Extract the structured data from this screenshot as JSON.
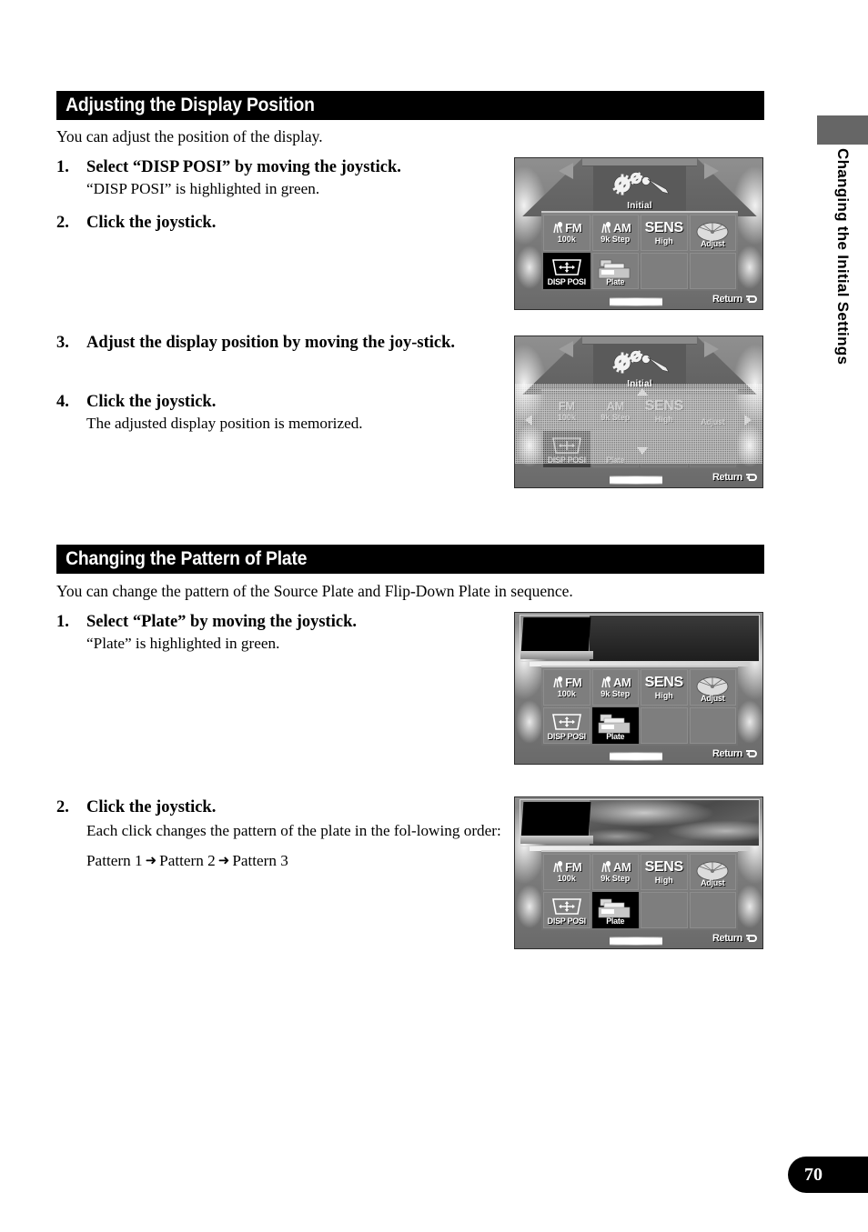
{
  "page": {
    "number": "70",
    "edge_tab_label": "Changing the Initial Settings"
  },
  "sections": [
    {
      "heading": "Adjusting the Display Position",
      "intro": "You can adjust the position of the display.",
      "steps": [
        {
          "num": "1.",
          "title": "Select “DISP POSI” by moving the joystick.",
          "body": "“DISP POSI” is highlighted in green."
        },
        {
          "num": "2.",
          "title": "Click the joystick.",
          "body": ""
        },
        {
          "num": "3.",
          "title": "Adjust the display position by moving the joy-stick.",
          "body": ""
        },
        {
          "num": "4.",
          "title": "Click the joystick.",
          "body": "The adjusted display position is memorized."
        }
      ]
    },
    {
      "heading": "Changing the Pattern of Plate",
      "intro": "You can change the pattern of the Source Plate and Flip-Down Plate in sequence.",
      "steps": [
        {
          "num": "1.",
          "title": "Select “Plate” by moving the joystick.",
          "body": "“Plate” is highlighted in green."
        },
        {
          "num": "2.",
          "title": "Click the joystick.",
          "body": "Each click changes the pattern of the plate in the fol-lowing order:",
          "sequence": [
            "Pattern 1",
            "Pattern 2",
            "Pattern 3"
          ],
          "sequence_arrow": "➜"
        }
      ]
    }
  ],
  "screens": [
    {
      "id": "screen-disp-posi-selected",
      "header_label": "Initial",
      "header_icon": "gears-icon",
      "selected_tile": "DISP POSI",
      "return_label": "Return",
      "tiles": [
        {
          "name": "fm-step",
          "main": "FM",
          "sub": "100k",
          "icon": "antenna-icon"
        },
        {
          "name": "am-step",
          "main": "AM",
          "sub": "9k Step",
          "icon": "antenna-icon"
        },
        {
          "name": "sens",
          "main": "SENS",
          "sub": "High",
          "icon": ""
        },
        {
          "name": "adjust",
          "main": "",
          "sub": "Adjust",
          "icon": "dial-icon"
        },
        {
          "name": "disp-posi",
          "main": "",
          "sub": "DISP POSI",
          "icon": "crosshair-screen-icon"
        },
        {
          "name": "plate",
          "main": "",
          "sub": "Plate",
          "icon": "plate-stack-icon"
        },
        {
          "name": "empty-1",
          "main": "",
          "sub": "",
          "icon": ""
        },
        {
          "name": "empty-2",
          "main": "",
          "sub": "",
          "icon": ""
        }
      ]
    },
    {
      "id": "screen-disp-posi-adjusting",
      "header_label": "Initial",
      "header_icon": "gears-icon",
      "selected_tile": "DISP POSI",
      "return_label": "Return",
      "state": "dithered-adjust",
      "arrows": [
        "up",
        "down",
        "left",
        "right"
      ]
    },
    {
      "id": "screen-plate-selected",
      "selected_tile": "Plate",
      "return_label": "Return",
      "plate_pattern": "Pattern 1",
      "plate_style": "flat-dark"
    },
    {
      "id": "screen-plate-pattern2",
      "selected_tile": "Plate",
      "return_label": "Return",
      "plate_pattern": "Pattern 2",
      "plate_style": "marble"
    }
  ],
  "colors": {
    "heading_bar": "#000000",
    "heading_text": "#ffffff",
    "edge_block": "#666666",
    "page_tab": "#000000",
    "body_text": "#000000"
  }
}
